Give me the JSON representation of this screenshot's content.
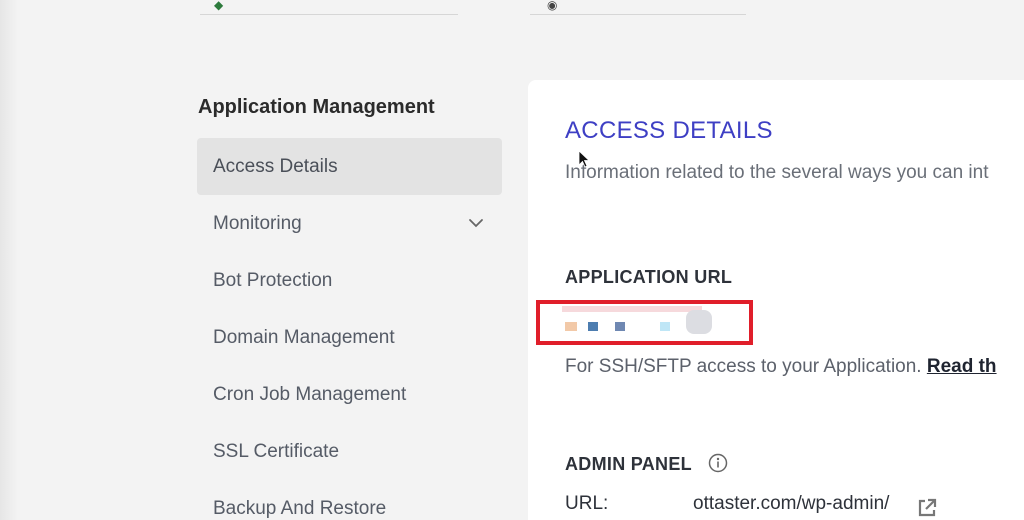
{
  "sidebar": {
    "heading": "Application Management",
    "items": [
      {
        "label": "Access Details",
        "active": true
      },
      {
        "label": "Monitoring",
        "has_chevron": true
      },
      {
        "label": "Bot Protection"
      },
      {
        "label": "Domain Management"
      },
      {
        "label": "Cron Job Management"
      },
      {
        "label": "SSL Certificate"
      },
      {
        "label": "Backup And Restore"
      }
    ]
  },
  "main": {
    "title": "ACCESS DETAILS",
    "description": "Information related to the several ways you can int",
    "application_url": {
      "label": "APPLICATION URL",
      "value_redacted": true,
      "highlight_color": "#e01e2a"
    },
    "ssh_note": {
      "text": "For SSH/SFTP access to your Application.",
      "link": "Read th"
    },
    "admin_panel": {
      "label": "ADMIN PANEL",
      "url_label": "URL:",
      "url_value": "ottaster.com/wp-admin/"
    }
  },
  "colors": {
    "accent": "#3e3fc4",
    "highlight": "#e01e2a",
    "page_bg": "#f3f3f3",
    "active_item_bg": "#e3e3e3"
  }
}
